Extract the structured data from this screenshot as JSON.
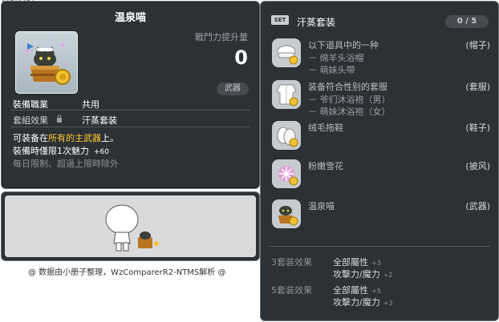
{
  "item_id": "01702654",
  "tooltip": {
    "name": "温泉喵",
    "power_label": "戰鬥力提升量",
    "power_value": "0",
    "category_badge": "武器",
    "job_label": "裝備職業",
    "job_value": "共用",
    "set_label": "套組效果",
    "set_name": "汗蒸套装",
    "desc_pre": "可装备在",
    "desc_highlight": "所有的主武器",
    "desc_post": "上。",
    "charm_text": "裝備時僅限1次魅力",
    "charm_value": "+60",
    "limit_text": "每日限制、超過上限時除外"
  },
  "footer": "@ 数据由小册子整理，WzComparerR2-NTMS解析 @",
  "set_panel": {
    "badge": "SET",
    "title": "汗蒸套装",
    "count": "0 / 5",
    "items": [
      {
        "icon": "hat-icon",
        "name": "以下道具中的一种",
        "subs": [
          "－ 绵羊头浴帽",
          "－ 萌妹头带"
        ],
        "slot": "(帽子)"
      },
      {
        "icon": "bathrobe-icon",
        "name": "装备符合性别的套服",
        "subs": [
          "－ 爷们沐浴袍（男）",
          "－ 萌妹沐浴袍（女）"
        ],
        "slot": "(套服)"
      },
      {
        "icon": "slippers-icon",
        "name": "绒毛拖鞋",
        "subs": [],
        "slot": "(鞋子)"
      },
      {
        "icon": "snowflake-cape-icon",
        "name": "粉嫩雪花",
        "subs": [],
        "slot": "(披风)"
      },
      {
        "icon": "cat-bucket-icon",
        "name": "温泉喵",
        "subs": [],
        "slot": "(武器)"
      }
    ],
    "effects": [
      {
        "label": "3套装效果",
        "stats": [
          {
            "name": "全部屬性",
            "value": "+3"
          },
          {
            "name": "攻擊力/魔力",
            "value": "+2"
          }
        ]
      },
      {
        "label": "5套装效果",
        "stats": [
          {
            "name": "全部屬性",
            "value": "+5"
          },
          {
            "name": "攻擊力/魔力",
            "value": "+3"
          }
        ]
      }
    ]
  },
  "colors": {
    "panel_bg": "#2c3136",
    "highlight": "#ffcc33",
    "muted": "#8d9296"
  }
}
